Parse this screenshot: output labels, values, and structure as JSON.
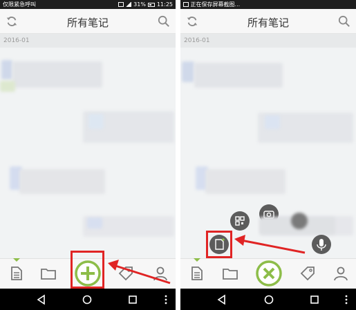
{
  "left": {
    "status": {
      "left_text": "仅限紧急呼叫",
      "battery": "31%",
      "time": "11:25"
    },
    "header": {
      "title": "所有笔记"
    },
    "date_label": "2016-01"
  },
  "right": {
    "status": {
      "left_text": "正在保存屏幕截图..."
    },
    "header": {
      "title": "所有笔记"
    },
    "date_label": "2016-01"
  },
  "icons": {
    "sync": "sync-icon",
    "search": "search-icon",
    "notes": "notes-icon",
    "folder": "folder-icon",
    "tag": "tag-icon",
    "user": "user-icon",
    "add": "plus-icon",
    "close": "close-icon",
    "qr": "qr-code-icon",
    "camera": "camera-icon",
    "mic": "microphone-icon",
    "new_note": "new-note-icon",
    "back": "back-icon",
    "home": "home-icon",
    "recents": "recents-icon",
    "menu": "more-icon"
  },
  "colors": {
    "accent": "#8dbd49",
    "highlight": "#e02424",
    "status_bar": "#1e1e1e",
    "nav_bar": "#000000"
  }
}
